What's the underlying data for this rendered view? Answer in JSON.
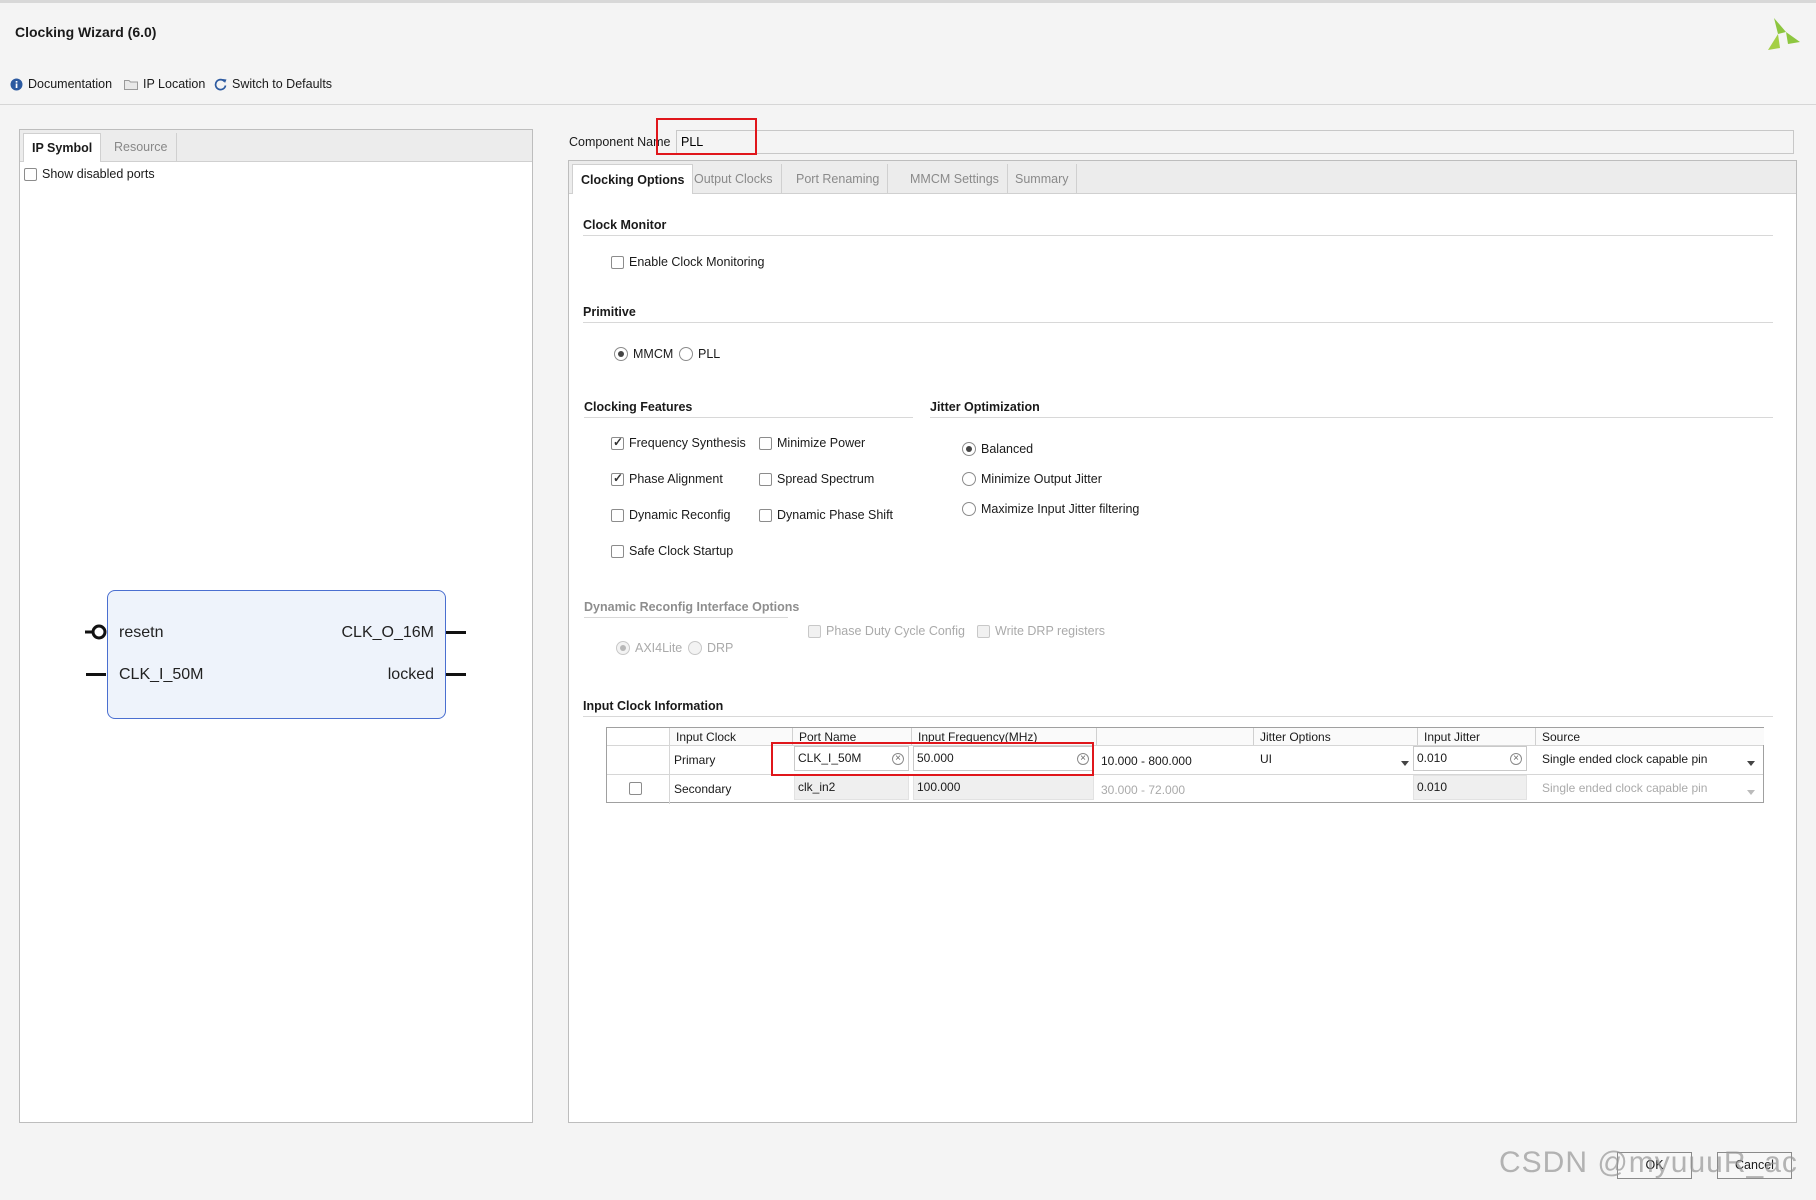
{
  "window": {
    "title": "Clocking Wizard (6.0)"
  },
  "toolbar": {
    "documentation": "Documentation",
    "ip_location": "IP Location",
    "switch_defaults": "Switch to Defaults"
  },
  "left_panel": {
    "tabs": [
      "IP Symbol",
      "Resource"
    ],
    "show_disabled_ports": "Show disabled ports",
    "ports": {
      "left": [
        "resetn",
        "CLK_I_50M"
      ],
      "right": [
        "CLK_O_16M",
        "locked"
      ]
    }
  },
  "component": {
    "label": "Component Name",
    "value": "PLL"
  },
  "tabs": [
    "Clocking Options",
    "Output Clocks",
    "Port Renaming",
    "MMCM Settings",
    "Summary"
  ],
  "clock_monitor": {
    "title": "Clock Monitor",
    "enable": "Enable Clock Monitoring"
  },
  "primitive": {
    "title": "Primitive",
    "mmcm": "MMCM",
    "pll": "PLL"
  },
  "features": {
    "title": "Clocking Features",
    "items": [
      "Frequency Synthesis",
      "Minimize Power",
      "Phase Alignment",
      "Spread Spectrum",
      "Dynamic Reconfig",
      "Dynamic Phase Shift",
      "Safe Clock Startup"
    ]
  },
  "jitter": {
    "title": "Jitter Optimization",
    "items": [
      "Balanced",
      "Minimize Output Jitter",
      "Maximize Input Jitter filtering"
    ]
  },
  "drp": {
    "title": "Dynamic Reconfig Interface Options",
    "axi": "AXI4Lite",
    "drp": "DRP",
    "phase_duty": "Phase Duty Cycle Config",
    "write_drp": "Write DRP registers"
  },
  "input_clock": {
    "title": "Input Clock Information",
    "headers": [
      "Input Clock",
      "Port Name",
      "Input Frequency(MHz)",
      "",
      "Jitter Options",
      "Input Jitter",
      "Source"
    ],
    "rows": [
      {
        "clock": "Primary",
        "port": "CLK_I_50M",
        "freq": "50.000",
        "range": "10.000 - 800.000",
        "jitter_opt": "UI",
        "jitter": "0.010",
        "source": "Single ended clock capable pin"
      },
      {
        "clock": "Secondary",
        "port": "clk_in2",
        "freq": "100.000",
        "range": "30.000 - 72.000",
        "jitter_opt": "",
        "jitter": "0.010",
        "source": "Single ended clock capable pin"
      }
    ]
  },
  "buttons": {
    "ok": "OK",
    "cancel": "Cancel"
  },
  "watermark": "CSDN @myuuuR_ac",
  "colors": {
    "highlight": "#e0161b",
    "logo": "#8dc63f"
  }
}
